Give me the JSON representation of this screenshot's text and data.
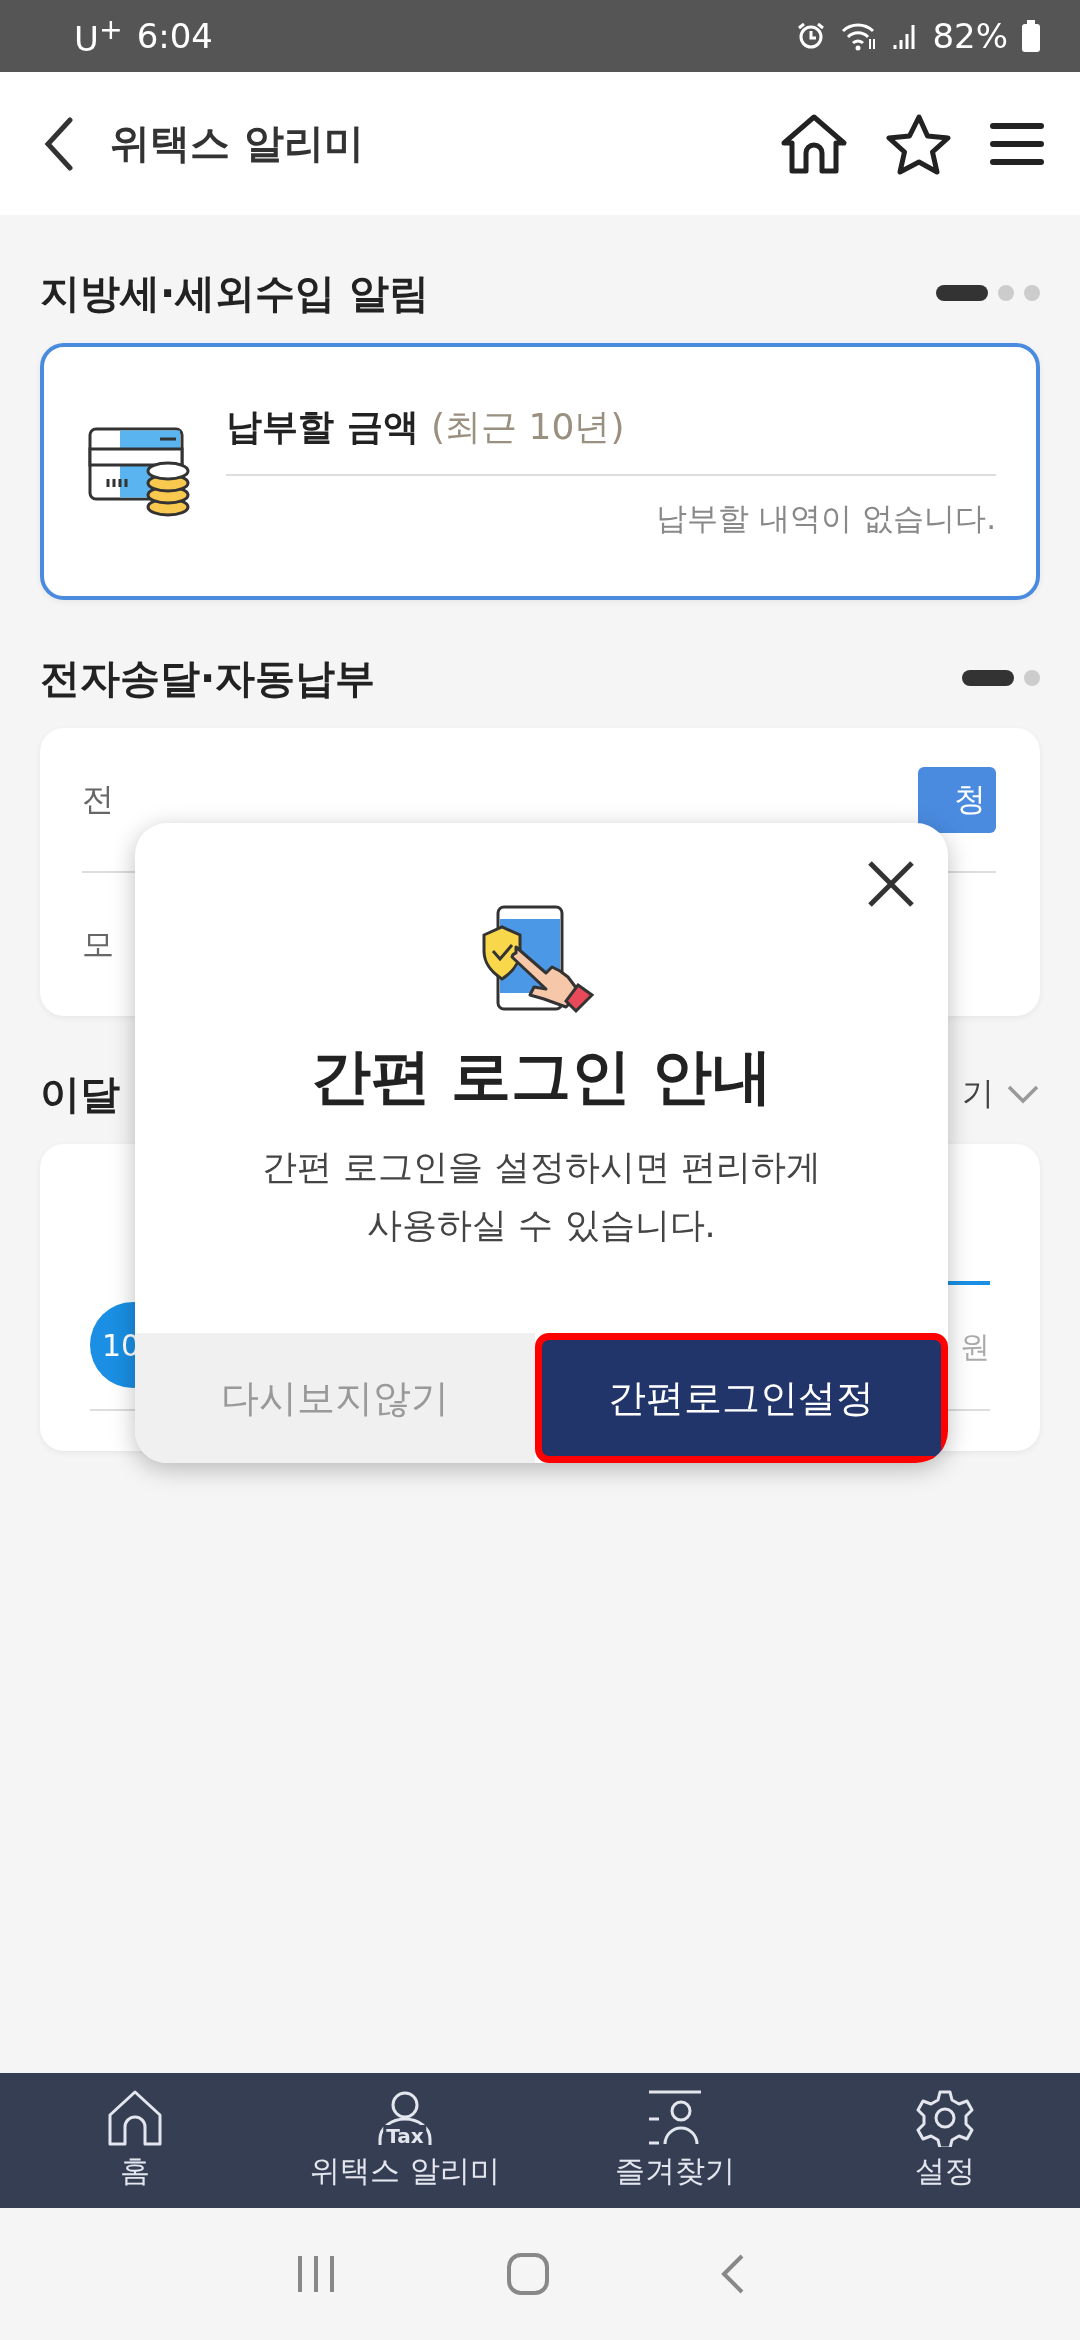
{
  "status_bar": {
    "carrier": "U$^{+}$",
    "time": "6:04",
    "battery": "82%"
  },
  "header": {
    "title": "위택스 알리미"
  },
  "local_tax": {
    "title": "지방세·세외수입 알림",
    "pages": [
      {
        "selected": true
      },
      {
        "selected": false
      },
      {
        "selected": false
      }
    ],
    "card": {
      "highlighted": true,
      "title": "납부할 금액",
      "note": "(최근 10년)",
      "message": "납부할 내역이 없습니다."
    }
  },
  "e_delivery": {
    "title": "전자송달·자동납부",
    "pages": [
      {
        "selected": true
      },
      {
        "selected": false
      }
    ],
    "rows": [
      {
        "label": "전",
        "button": "청"
      },
      {
        "label": "모"
      }
    ]
  },
  "this_month": {
    "title": "이달",
    "link": "기",
    "month_badge": "10",
    "amount_unit": "원"
  },
  "dialog": {
    "title": "간편 로그인 안내",
    "message": "간편 로그인을 설정하시면 편리하게\n사용하실 수 있습니다.",
    "buttons": [
      {
        "label": "다시보지않기",
        "kind": "secondary",
        "highlighted": false
      },
      {
        "label": "간편로그인설정",
        "kind": "primary",
        "highlighted": true
      }
    ]
  },
  "bottom_nav": [
    {
      "label": "홈",
      "kind": "home"
    },
    {
      "label": "위택스 알리미",
      "kind": "person",
      "icon_text": "Tax"
    },
    {
      "label": "즐겨찾기",
      "kind": "favorites"
    },
    {
      "label": "설정",
      "kind": "settings"
    }
  ]
}
